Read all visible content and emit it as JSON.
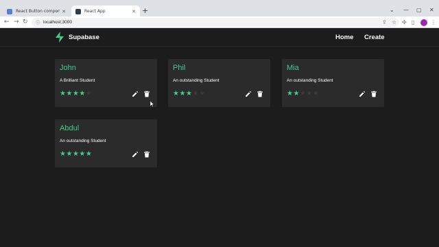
{
  "browser": {
    "tabs": [
      {
        "title": "React Button component - Mate",
        "favicon_color": "#5b7cd6",
        "active": false
      },
      {
        "title": "React App",
        "favicon_color": "#2c3e50",
        "active": true
      }
    ],
    "new_tab_label": "+",
    "address": "localhost:3000"
  },
  "app": {
    "brand": "Supabase",
    "nav": [
      "Home",
      "Create"
    ],
    "accent": "#3ecf8e"
  },
  "cards": [
    {
      "name": "John",
      "description": "A Brilliant Student",
      "rating": 4
    },
    {
      "name": "Phil",
      "description": "An outstanding Student",
      "rating": 3
    },
    {
      "name": "Mia",
      "description": "An outstanding Student",
      "rating": 2
    },
    {
      "name": "Abdul",
      "description": "An outstanding Student",
      "rating": 5
    }
  ],
  "max_rating": 5
}
